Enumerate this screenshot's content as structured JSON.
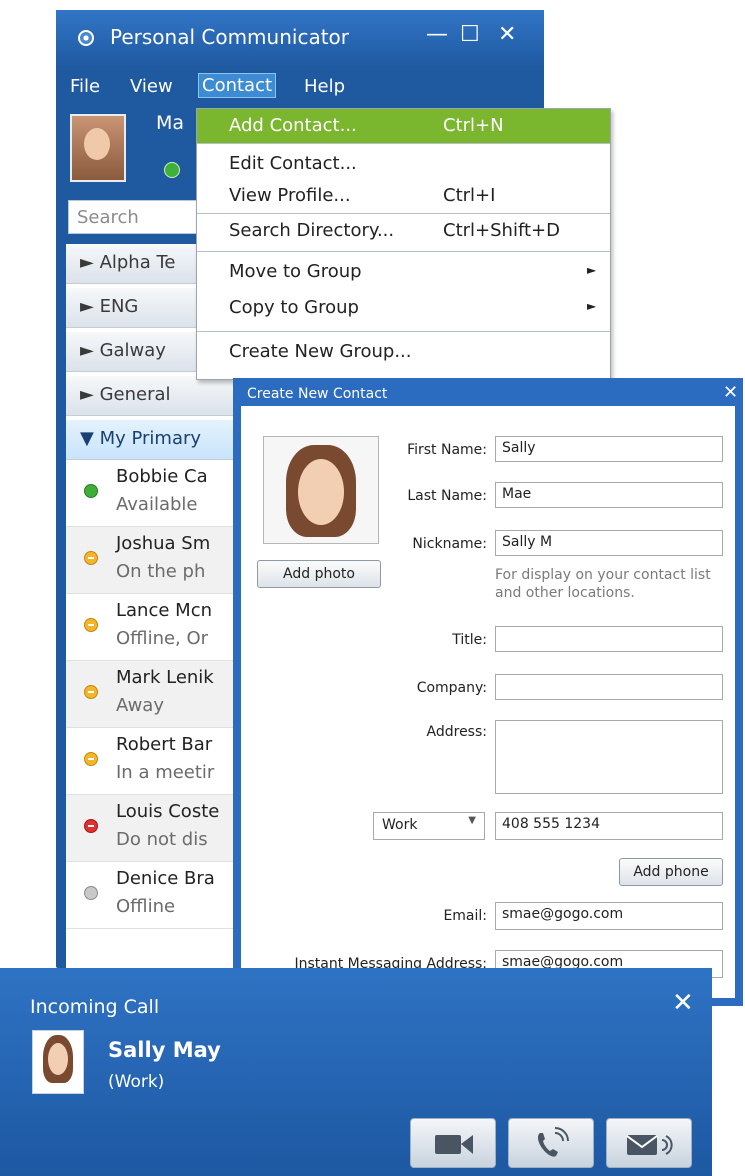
{
  "main_window": {
    "title": "Personal Communicator",
    "window_buttons": {
      "minimize": "—",
      "maximize": "☐",
      "close": "✕"
    },
    "menus": [
      "File",
      "View",
      "Contact",
      "Help"
    ],
    "user": {
      "name_partial": "Ma",
      "status": "available"
    },
    "search_placeholder": "Search",
    "groups": [
      {
        "label": "► Alpha Te"
      },
      {
        "label": "► ENG"
      },
      {
        "label": "► Galway"
      },
      {
        "label": "► General"
      },
      {
        "label": "▼ My Primary"
      }
    ],
    "contacts": [
      {
        "name": "Bobbie Ca",
        "status_text": "Available",
        "status": "available"
      },
      {
        "name": "Joshua Sm",
        "status_text": "On the ph",
        "status": "away"
      },
      {
        "name": "Lance Mcn",
        "status_text": "Offline, Or",
        "status": "away"
      },
      {
        "name": "Mark Lenik",
        "status_text": "Away",
        "status": "away"
      },
      {
        "name": "Robert Bar",
        "status_text": "In a meetir",
        "status": "away"
      },
      {
        "name": "Louis Coste",
        "status_text": "Do not dis",
        "status": "dnd"
      },
      {
        "name": "Denice Bra",
        "status_text": "Offline",
        "status": "offline"
      }
    ]
  },
  "contact_menu": {
    "items": [
      {
        "label": "Add Contact...",
        "shortcut": "Ctrl+N",
        "highlighted": true
      },
      {
        "label": "Edit Contact...",
        "shortcut": ""
      },
      {
        "label": "View Profile...",
        "shortcut": "Ctrl+I"
      },
      {
        "label": "Search Directory...",
        "shortcut": "Ctrl+Shift+D"
      },
      {
        "label": "Move to Group",
        "shortcut": "",
        "submenu": "►"
      },
      {
        "label": "Copy to Group",
        "shortcut": "",
        "submenu": "►"
      },
      {
        "label": "Create New Group...",
        "shortcut": ""
      }
    ]
  },
  "new_contact_dialog": {
    "title": "Create New Contact",
    "close": "✕",
    "add_photo_label": "Add photo",
    "fields": {
      "first_name": {
        "label": "First Name:",
        "value": "Sally"
      },
      "last_name": {
        "label": "Last Name:",
        "value": "Mae"
      },
      "nickname": {
        "label": "Nickname:",
        "value": "Sally M"
      },
      "nickname_hint": "For display on your contact list and other locations.",
      "title": {
        "label": "Title:",
        "value": ""
      },
      "company": {
        "label": "Company:",
        "value": ""
      },
      "address": {
        "label": "Address:",
        "value": ""
      },
      "phone_type": "Work",
      "phone": "408 555 1234",
      "add_phone_label": "Add phone",
      "email": {
        "label": "Email:",
        "value": "smae@gogo.com"
      },
      "im_address": {
        "label": "Instant Messaging Address:",
        "value": "smae@gogo.com"
      }
    }
  },
  "incoming_call": {
    "title": "Incoming Call",
    "close": "✕",
    "caller_name": "Sally May",
    "caller_type": "(Work)"
  }
}
